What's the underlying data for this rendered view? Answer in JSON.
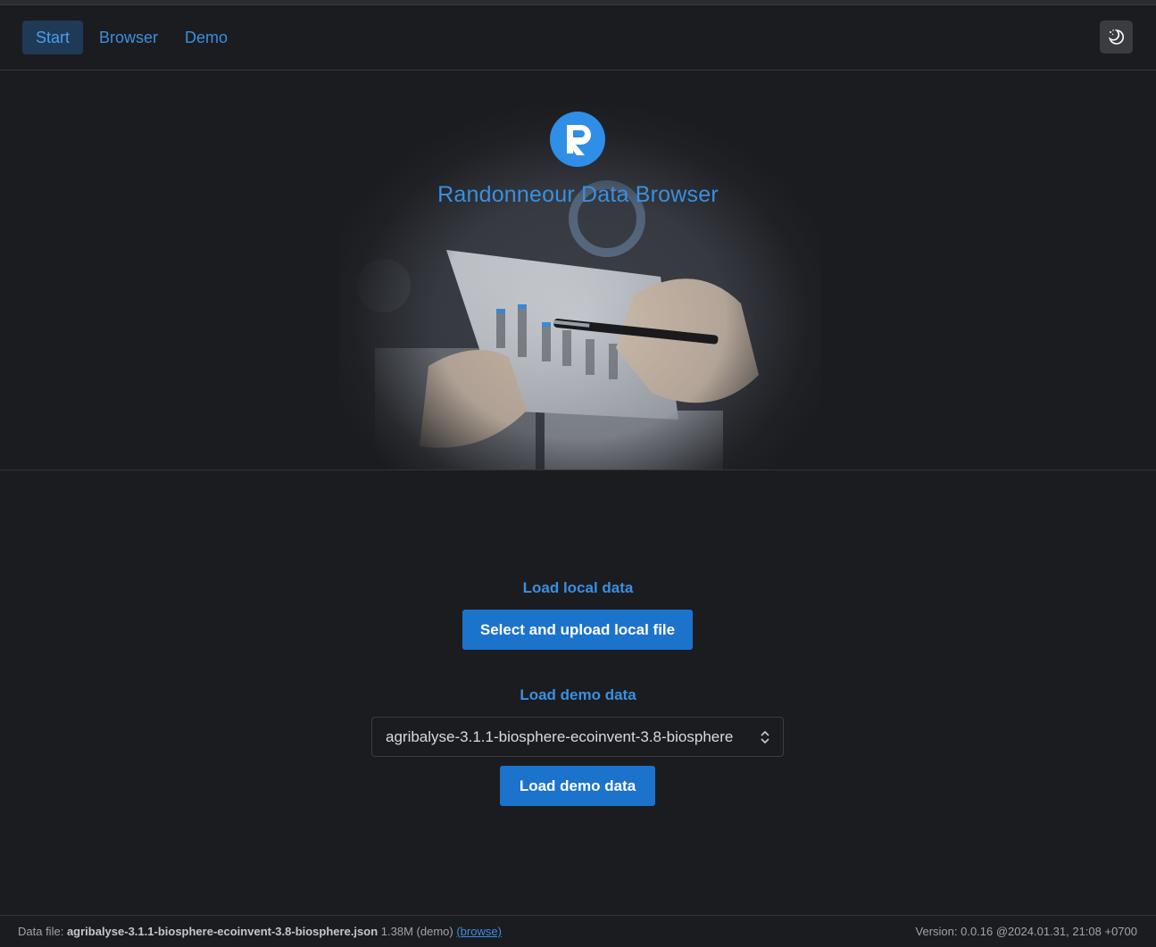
{
  "nav": {
    "tabs": [
      {
        "label": "Start",
        "active": true
      },
      {
        "label": "Browser",
        "active": false
      },
      {
        "label": "Demo",
        "active": false
      }
    ],
    "theme_toggle_icon": "moon-stars-icon"
  },
  "hero": {
    "logo_icon": "randonneur-logo-icon",
    "title": "Randonneour Data Browser"
  },
  "local": {
    "heading": "Load local data",
    "button_label": "Select and upload local file"
  },
  "demo": {
    "heading": "Load demo data",
    "selected_option": "agribalyse-3.1.1-biosphere-ecoinvent-3.8-biosphere",
    "button_label": "Load demo data"
  },
  "footer": {
    "data_file_label": "Data file:",
    "data_file_name": "agribalyse-3.1.1-biosphere-ecoinvent-3.8-biosphere.json",
    "data_file_meta": "1.38M (demo)",
    "browse_link": "(browse)",
    "version": "Version: 0.0.16 @2024.01.31, 21:08 +0700"
  },
  "colors": {
    "background": "#1b1c20",
    "accent": "#3a8fe0",
    "button": "#1c73cc"
  }
}
